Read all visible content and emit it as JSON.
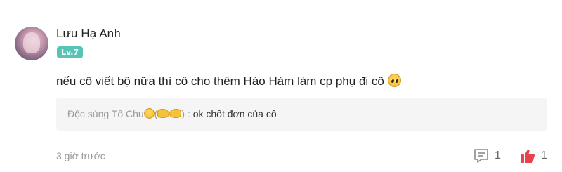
{
  "comment": {
    "author": "Lưu Hạ Anh",
    "level": "Lv.7",
    "text": "nếu cô viết bộ nữa thì cô cho thêm Hào Hàm làm cp phụ đi cô",
    "text_emoji": "pleading-face",
    "timestamp": "3 giờ trước",
    "reply_count": "1",
    "like_count": "1"
  },
  "reply": {
    "author": "Độc sủng Tô Chu",
    "author_open_paren": "(",
    "author_close_paren": ")",
    "separator": ":",
    "text": "ok chốt đơn của cô"
  },
  "colors": {
    "level_badge": "#57c4b5",
    "like_icon": "#e8424d",
    "reply_bg": "#f5f5f5"
  },
  "icons": {
    "reply": "comment-bubble-icon",
    "like": "thumbs-up-icon"
  }
}
